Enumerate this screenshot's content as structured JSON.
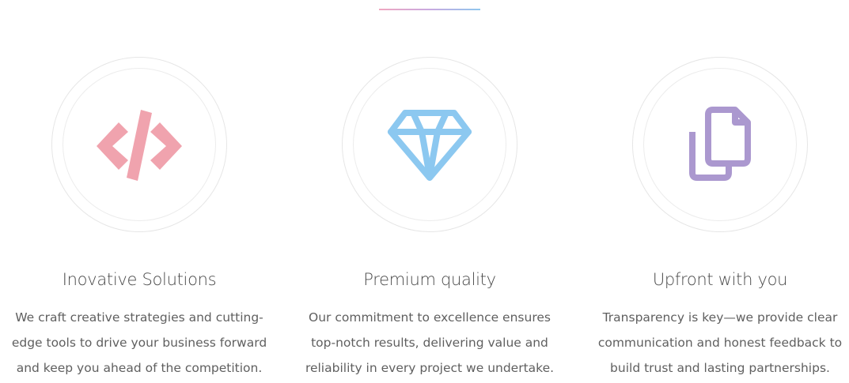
{
  "colors": {
    "divider_start": "#f0a7c0",
    "divider_end": "#8fc7ee",
    "code_icon": "#f0a3ae",
    "diamond_icon": "#8cc8f0",
    "files_icon": "#ab98cf"
  },
  "features": [
    {
      "icon": "code-icon",
      "title": "Inovative Solutions",
      "description": "We craft creative strategies and cutting-edge tools to drive your business forward and keep you ahead of the competition."
    },
    {
      "icon": "diamond-icon",
      "title": "Premium quality",
      "description": "Our commitment to excellence ensures top-notch results, delivering value and reliability in every project we undertake."
    },
    {
      "icon": "files-icon",
      "title": "Upfront with you",
      "description": "Transparency is key—we provide clear communication and honest feedback to build trust and lasting partnerships."
    }
  ]
}
